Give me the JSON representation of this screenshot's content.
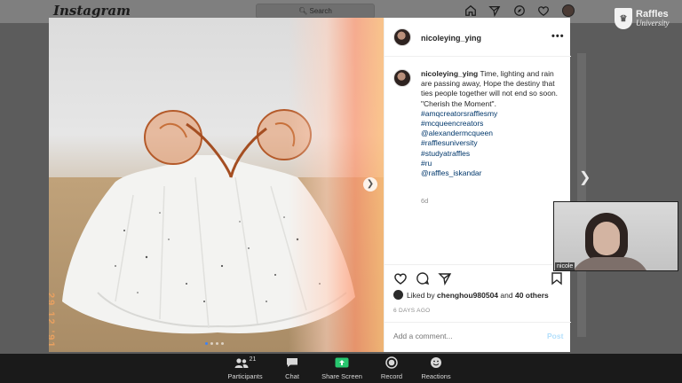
{
  "instagram": {
    "logo": "Instagram",
    "search_placeholder": "Search",
    "nav_icons": [
      "home-icon",
      "direct-icon",
      "explore-icon",
      "activity-icon"
    ]
  },
  "branding": {
    "line1": "Raffles",
    "line2": "University"
  },
  "post": {
    "username": "nicoleying_ying",
    "caption": {
      "text": "Time, lighting and rain are passing away, Hope the destiny that ties people together will not end so soon. \"Cherish the Moment\".",
      "tags": [
        "#amqcreatorsrafflesmy",
        "#mcqueencreators",
        "@alexandermcqueen",
        "#rafflesuniversity",
        "#studyatraffles",
        "#ru",
        "@raffles_iskandar"
      ],
      "time": "6d"
    },
    "photo_stamp": "29 12 '91",
    "likes": {
      "liked_by_prefix": "Liked by",
      "user": "chenghou980504",
      "and": "and",
      "others": "40 others"
    },
    "posted_ago": "6 DAYS AGO",
    "comment_placeholder": "Add a comment...",
    "post_button": "Post"
  },
  "video": {
    "participant_name": "nicole"
  },
  "zoom_toolbar": {
    "participants": {
      "label": "Participants",
      "count": "21"
    },
    "chat": {
      "label": "Chat"
    },
    "share": {
      "label": "Share Screen"
    },
    "record": {
      "label": "Record"
    },
    "reactions": {
      "label": "Reactions"
    }
  },
  "colors": {
    "share_green": "#28c76f",
    "link_blue": "#00376b",
    "zoom_bar": "#1a1a1a"
  }
}
